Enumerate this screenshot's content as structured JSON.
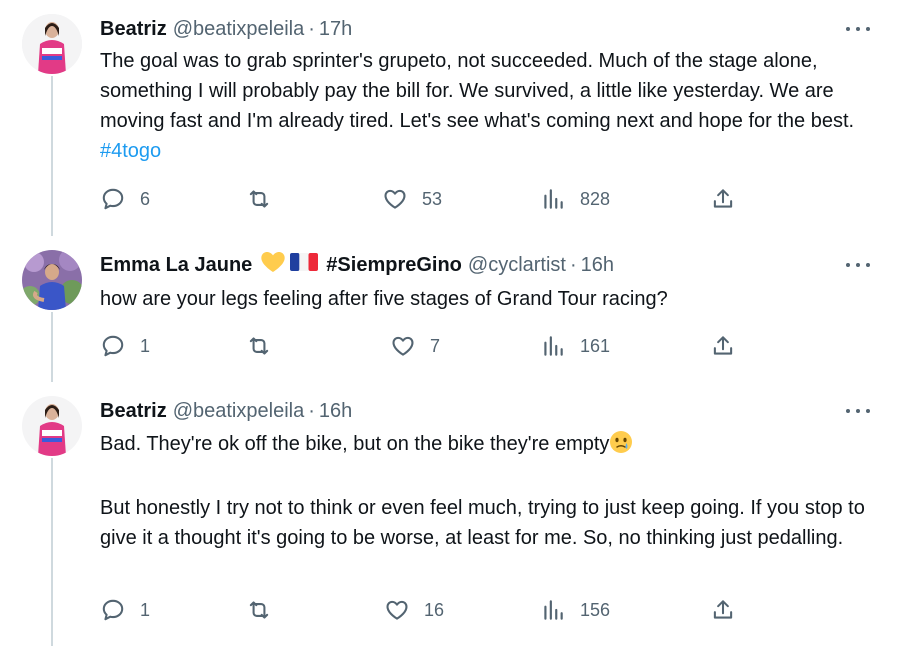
{
  "tweets": [
    {
      "name": "Beatriz",
      "handle": "@beatixpeleila",
      "separator": "·",
      "time": "17h",
      "paragraphs": [
        "The goal was to grab sprinter's grupeto, not succeeded. Much of the stage alone, something I will probably pay the bill for. We survived, a little like yesterday. We are moving fast and I'm already tired. Let's see what's coming next and hope for the best. "
      ],
      "hashtag": "#4togo",
      "stats": {
        "replies": "6",
        "retweets": "",
        "likes": "53",
        "views": "828"
      }
    },
    {
      "name": "Emma La Jaune",
      "name_emojis": [
        "yellow-heart",
        "france-flag"
      ],
      "name_suffix": "#SiempreGino",
      "handle": "@cyclartist",
      "separator": "·",
      "time": "16h",
      "paragraphs": [
        "how are your legs feeling after five stages of Grand Tour racing?"
      ],
      "stats": {
        "replies": "1",
        "retweets": "",
        "likes": "7",
        "views": "161"
      }
    },
    {
      "name": "Beatriz",
      "handle": "@beatixpeleila",
      "separator": "·",
      "time": "16h",
      "paragraphs": [
        "Bad. They're ok off the bike, but on the bike they're empty",
        "But honestly I try not to think or even feel much, trying to just keep going. If you stop to give it a thought it's going to be worse, at least for me. So, no thinking just pedalling."
      ],
      "inline_emoji": "face-holding-back-tears",
      "stats": {
        "replies": "1",
        "retweets": "",
        "likes": "16",
        "views": "156"
      }
    }
  ],
  "colors": {
    "text": "#0f1419",
    "secondary": "#536471",
    "link": "#1d9bf0",
    "thread_line": "#cfd9de"
  }
}
